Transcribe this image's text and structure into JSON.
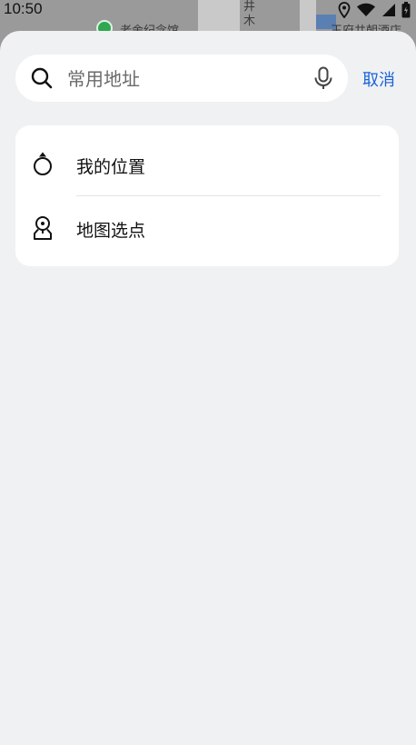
{
  "status_bar": {
    "time": "10:50",
    "icons": [
      "location-icon",
      "wifi-icon",
      "battery-icon"
    ]
  },
  "map_background": {
    "labels": [
      "老舍纪念馆",
      "井木",
      "王府井朝酒店"
    ]
  },
  "search": {
    "placeholder": "常用地址",
    "value": ""
  },
  "cancel_label": "取消",
  "options": [
    {
      "label": "我的位置",
      "icon": "my-location-icon"
    },
    {
      "label": "地图选点",
      "icon": "map-pick-point-icon"
    }
  ],
  "colors": {
    "accent": "#1a63d8",
    "sheet_bg": "#f0f1f3",
    "card_bg": "#ffffff"
  }
}
